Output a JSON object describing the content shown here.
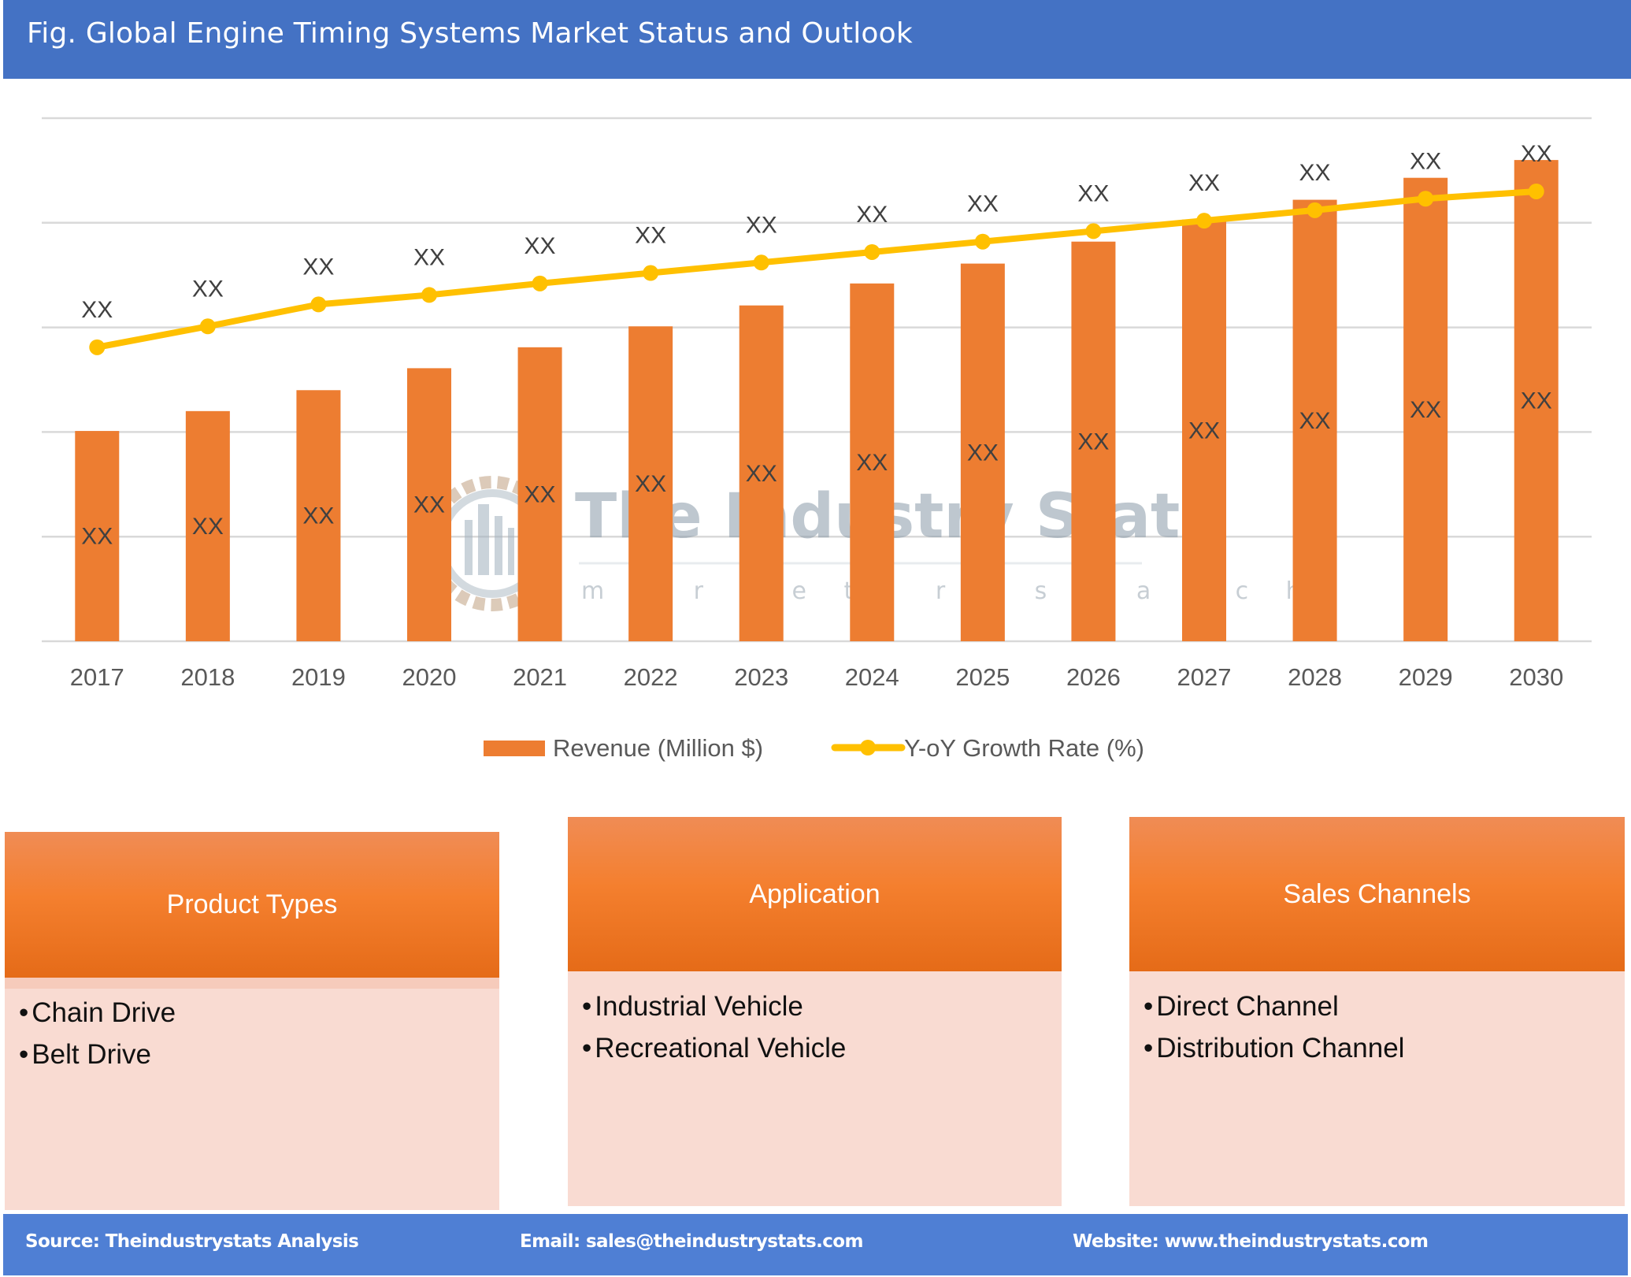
{
  "header": {
    "title": "Fig. Global Engine Timing Systems Market Status and Outlook"
  },
  "colors": {
    "header_bg": "#4472c4",
    "bar": "#ed7d31",
    "line": "#ffc000",
    "footer_bg": "#4f7fd4",
    "panel_body": "#f9dbd2"
  },
  "chart_data": {
    "type": "bar+line",
    "title": "",
    "xlabel": "",
    "ylabel": "",
    "categories": [
      "2017",
      "2018",
      "2019",
      "2020",
      "2021",
      "2022",
      "2023",
      "2024",
      "2025",
      "2026",
      "2027",
      "2028",
      "2029",
      "2030"
    ],
    "ylim": [
      0,
      500
    ],
    "grid": true,
    "y_ticks_labeled": false,
    "series": [
      {
        "name": "Revenue (Million $)",
        "type": "bar",
        "values": [
          201,
          220,
          240,
          261,
          281,
          301,
          321,
          342,
          361,
          382,
          403,
          422,
          443,
          460
        ],
        "data_labels": [
          "XX",
          "XX",
          "XX",
          "XX",
          "XX",
          "XX",
          "XX",
          "XX",
          "XX",
          "XX",
          "XX",
          "XX",
          "XX",
          "XX"
        ]
      },
      {
        "name": "Y-oY Growth Rate (%)",
        "type": "line",
        "values": [
          281,
          301,
          322,
          331,
          342,
          352,
          362,
          372,
          382,
          392,
          402,
          412,
          423,
          430
        ],
        "data_labels": [
          "XX",
          "XX",
          "XX",
          "XX",
          "XX",
          "XX",
          "XX",
          "XX",
          "XX",
          "XX",
          "XX",
          "XX",
          "XX",
          "XX"
        ]
      }
    ],
    "note": "Values are relative (axis unlabeled); all data labels read 'XX'",
    "legend": {
      "position": "bottom",
      "entries": [
        "Revenue (Million $)",
        "Y-oY Growth Rate (%)"
      ]
    }
  },
  "watermark": {
    "name": "The Industry Stats",
    "tagline": "m a r k e t   r e s e a r c h"
  },
  "panels": [
    {
      "title": "Product Types",
      "items": [
        "Chain Drive",
        "Belt Drive"
      ]
    },
    {
      "title": "Application",
      "items": [
        "Industrial Vehicle",
        "Recreational Vehicle"
      ]
    },
    {
      "title": "Sales Channels",
      "items": [
        "Direct Channel",
        "Distribution Channel"
      ]
    }
  ],
  "footer": {
    "source": "Source: Theindustrystats Analysis",
    "email": "Email: sales@theindustrystats.com",
    "website": "Website: www.theindustrystats.com"
  }
}
